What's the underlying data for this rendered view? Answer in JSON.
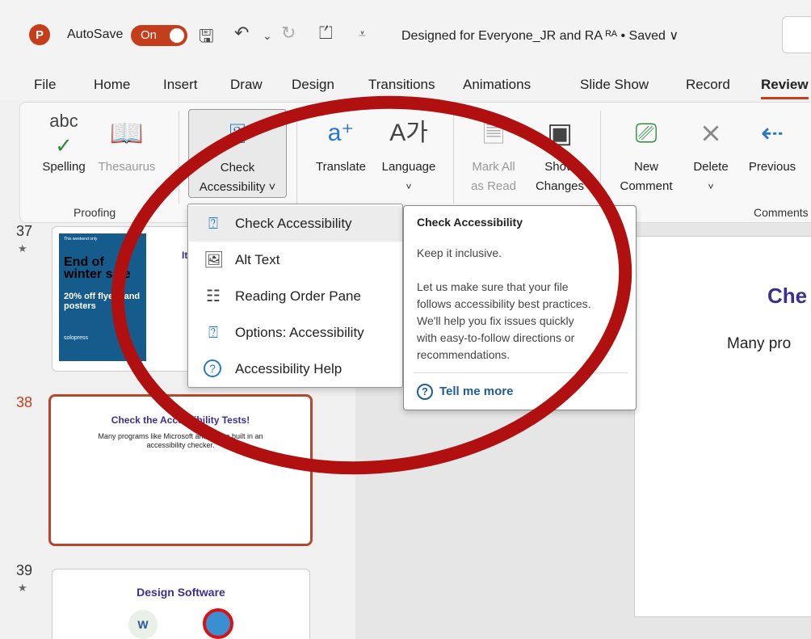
{
  "titlebar": {
    "app_icon_letter": "P",
    "autosave_label": "AutoSave",
    "autosave_state": "On",
    "doc_title": "Designed for Everyone_JR and RA  ᴿᴬ  •  Saved ∨",
    "quick_access_icons": [
      "save-icon",
      "undo-icon",
      "redo-icon",
      "present-icon",
      "customize-icon"
    ]
  },
  "tabs": [
    "File",
    "Home",
    "Insert",
    "Draw",
    "Design",
    "Transitions",
    "Animations",
    "Slide Show",
    "Record",
    "Review"
  ],
  "active_tab": "Review",
  "ribbon": {
    "spelling": "Spelling",
    "spelling_icon_text": "abc",
    "thesaurus": "Thesaurus",
    "check_accessibility_line1": "Check",
    "check_accessibility_line2": "Accessibility ˅",
    "translate": "Translate",
    "language": "Language",
    "mark_all_line1": "Mark All",
    "mark_all_line2": "as Read",
    "show_changes_line1": "Show",
    "show_changes_line2": "Changes",
    "new_comment_line1": "New",
    "new_comment_line2": "Comment",
    "delete": "Delete",
    "previous": "Previous",
    "group_proofing": "Proofing",
    "group_comments": "Comments"
  },
  "dropdown": {
    "items": [
      {
        "label": "Check Accessibility",
        "icon": "check-accessibility-icon"
      },
      {
        "label": "Alt Text",
        "icon": "alt-text-icon"
      },
      {
        "label": "Reading Order Pane",
        "icon": "reading-order-icon"
      },
      {
        "label": "Options: Accessibility",
        "icon": "options-accessibility-icon"
      },
      {
        "label": "Accessibility Help",
        "icon": "help-icon"
      }
    ]
  },
  "tooltip": {
    "title": "Check Accessibility",
    "subtitle": "Keep it inclusive.",
    "lines": [
      "Let us make sure that your file",
      "follows accessibility best practices.",
      "We'll help you fix issues quickly",
      "with easy-to-follow directions or",
      "recommendations."
    ],
    "link": "Tell me more"
  },
  "slides": [
    {
      "number": "37",
      "promo": {
        "top": "This weekend only",
        "headline": "End of winter sale",
        "offer": "20% off flyers and posters",
        "brand": "solopress"
      },
      "title_fragment": "It"
    },
    {
      "number": "38",
      "title": "Check the Accessibility Tests!",
      "body": "Many programs like Microsoft and Adobe built in an accessibility checker."
    },
    {
      "number": "39",
      "title": "Design Software"
    }
  ],
  "canvas": {
    "title_fragment": "Che",
    "body_fragment": "Many pro"
  },
  "colors": {
    "brand": "#c43e1c",
    "title_purple": "#3c2f8f",
    "annotation_red": "#b01010"
  }
}
